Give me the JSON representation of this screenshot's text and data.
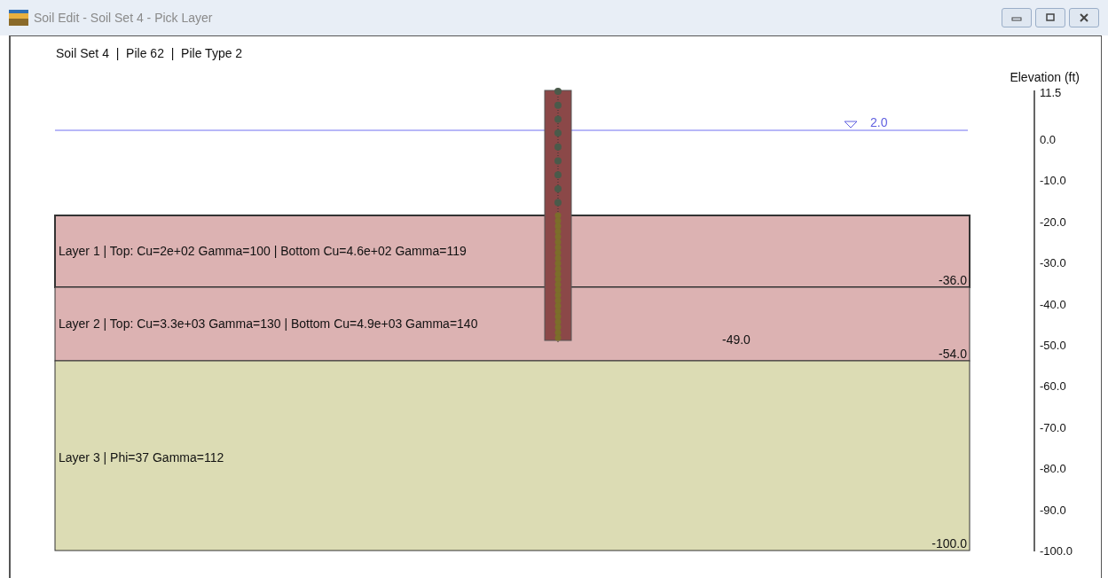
{
  "window": {
    "title": "Soil Edit - Soil Set 4 - Pick Layer"
  },
  "header": "Soil Set 4  |  Pile 62  |  Pile Type 2",
  "water_level": {
    "label": "2.0"
  },
  "pile": {
    "tip_label": "-49.0"
  },
  "layers": [
    {
      "label": "Layer 1 | Top: Cu=2e+02 Gamma=100 | Bottom Cu=4.6e+02 Gamma=119",
      "bottom_label": "-36.0",
      "color": "#dcb2b2",
      "selected": true
    },
    {
      "label": "Layer 2 | Top: Cu=3.3e+03 Gamma=130 | Bottom Cu=4.9e+03 Gamma=140",
      "bottom_label": "-54.0",
      "color": "#dcb2b2",
      "selected": false
    },
    {
      "label": "Layer 3 | Phi=37 Gamma=112",
      "bottom_label": "-100.0",
      "color": "#dcdcb4",
      "selected": false
    }
  ],
  "axis": {
    "title": "Elevation (ft)",
    "ticks": [
      "11.5",
      "0.0",
      "-10.0",
      "-20.0",
      "-30.0",
      "-40.0",
      "-50.0",
      "-60.0",
      "-70.0",
      "-80.0",
      "-90.0",
      "-100.0"
    ]
  }
}
